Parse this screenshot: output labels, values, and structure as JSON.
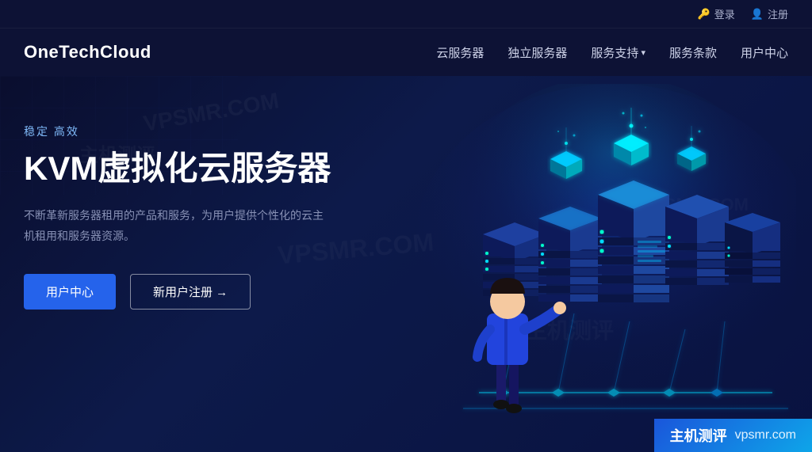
{
  "topbar": {
    "login_label": "登录",
    "register_label": "注册"
  },
  "header": {
    "logo": "OneTechCloud",
    "nav": [
      {
        "label": "云服务器",
        "has_dropdown": false
      },
      {
        "label": "独立服务器",
        "has_dropdown": false
      },
      {
        "label": "服务支持",
        "has_dropdown": true
      },
      {
        "label": "服务条款",
        "has_dropdown": false
      },
      {
        "label": "用户中心",
        "has_dropdown": false
      }
    ]
  },
  "hero": {
    "subtitle": "稳定 高效",
    "title": "KVM虚拟化云服务器",
    "desc": "不断革新服务器租用的产品和服务，为用户提供个性化的云主机租用和服务器资源。",
    "btn_primary": "用户中心",
    "btn_outline": "新用户注册 →"
  },
  "bottom_bar": {
    "label": "主机测评",
    "url": "vpsmr.com"
  },
  "watermarks": [
    "VPSMR.COM",
    "主机测评"
  ]
}
